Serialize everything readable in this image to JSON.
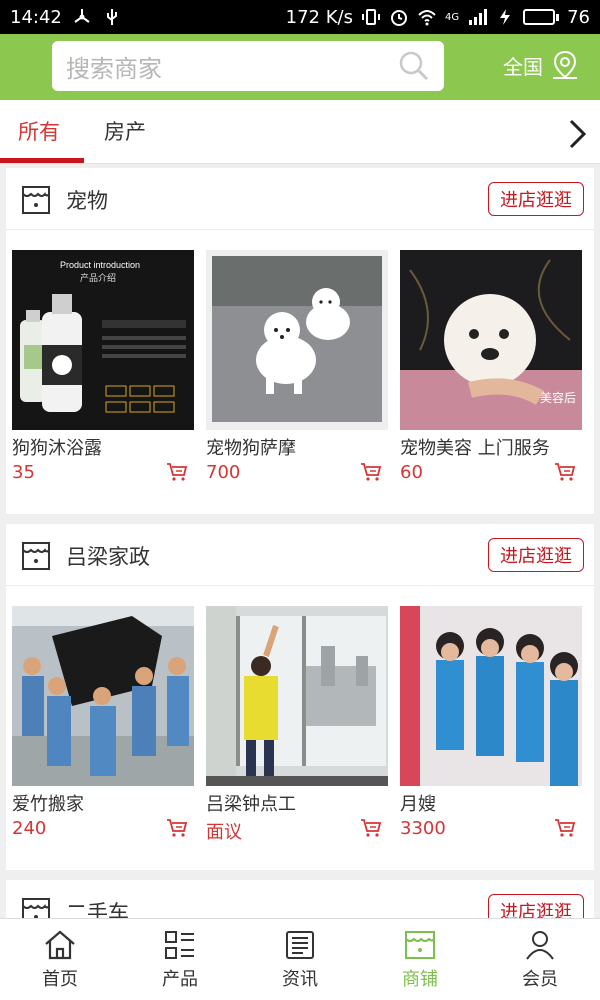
{
  "status_bar": {
    "time": "14:42",
    "net_speed": "172 K/s",
    "network_type": "4G",
    "battery": "76",
    "battery_level": 0.76
  },
  "header": {
    "search_placeholder": "搜索商家",
    "region_label": "全国"
  },
  "tabs": [
    {
      "label": "所有",
      "active": true
    },
    {
      "label": "房产",
      "active": false
    }
  ],
  "stores": [
    {
      "name": "宠物",
      "visit_label": "进店逛逛",
      "products": [
        {
          "name": "狗狗沐浴露",
          "price": "35",
          "img_title": "Product introduction",
          "img_subtitle": "产品介绍"
        },
        {
          "name": "宠物狗萨摩",
          "price": "700"
        },
        {
          "name": "宠物美容 上门服务",
          "price": "60",
          "img_badge": "美容后"
        }
      ]
    },
    {
      "name": "吕梁家政",
      "visit_label": "进店逛逛",
      "products": [
        {
          "name": "爱竹搬家",
          "price": "240"
        },
        {
          "name": "吕梁钟点工",
          "price": "面议"
        },
        {
          "name": "月嫂",
          "price": "3300"
        }
      ]
    },
    {
      "name": "二手车",
      "visit_label": "进店逛逛",
      "products": []
    }
  ],
  "bottom_nav": [
    {
      "label": "首页",
      "icon": "home-icon",
      "active": false
    },
    {
      "label": "产品",
      "icon": "list-icon",
      "active": false
    },
    {
      "label": "资讯",
      "icon": "news-icon",
      "active": false
    },
    {
      "label": "商铺",
      "icon": "store-icon",
      "active": true
    },
    {
      "label": "会员",
      "icon": "user-icon",
      "active": false
    }
  ],
  "colors": {
    "brand_green": "#8cc850",
    "accent_red": "#c8161d",
    "price_red": "#d63535",
    "nav_active": "#7cbf4b"
  }
}
